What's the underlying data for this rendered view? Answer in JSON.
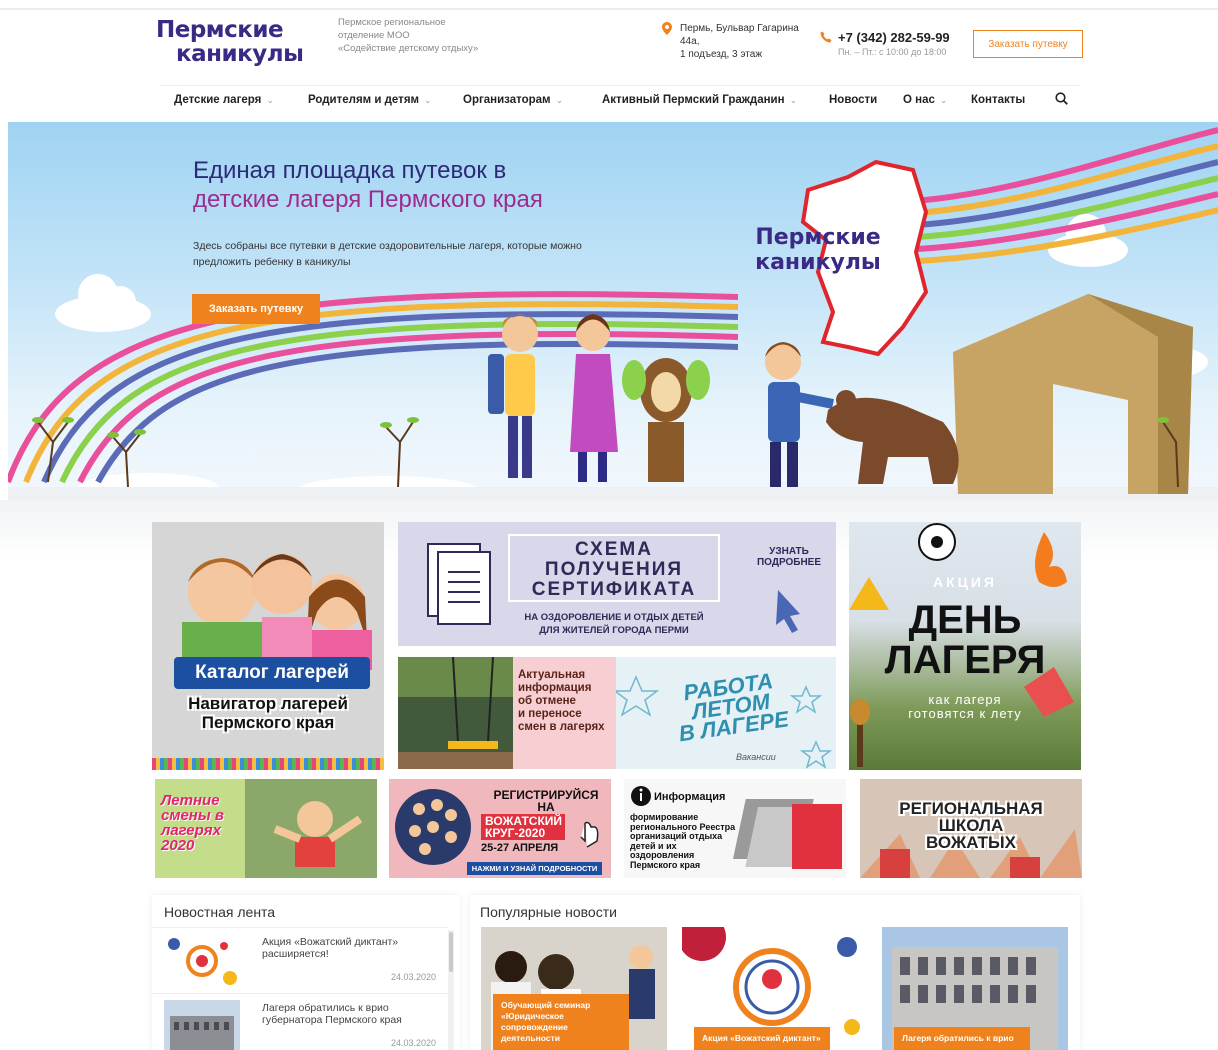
{
  "header": {
    "logo_line1": "Пермские",
    "logo_line2": "каникулы",
    "org_line1": "Пермское региональное",
    "org_line2": "отделение МОО",
    "org_line3": "«Содействие детскому отдыху»",
    "address_line1": "Пермь, Бульвар Гагарина",
    "address_line2": "44а,",
    "address_line3": "1 подъезд, 3 этаж",
    "phone": "+7 (342) 282-59-99",
    "hours": "Пн. – Пт.: с 10:00 до 18:00",
    "order_button": "Заказать путевку"
  },
  "nav": {
    "items": [
      {
        "label": "Детские лагеря",
        "has_dropdown": true
      },
      {
        "label": "Родителям и детям",
        "has_dropdown": true
      },
      {
        "label": "Организаторам",
        "has_dropdown": true
      },
      {
        "label": "Активный Пермский Гражданин",
        "has_dropdown": true
      },
      {
        "label": "Новости",
        "has_dropdown": false
      },
      {
        "label": "О нас",
        "has_dropdown": true
      },
      {
        "label": "Контакты",
        "has_dropdown": false
      }
    ],
    "search_icon": "search-icon"
  },
  "hero": {
    "title_line1": "Единая площадка путевок в",
    "title_line2": "детские лагеря Пермского края",
    "description": "Здесь собраны все путевки в детские оздоровительные лагеря, которые можно предложить ребенку в каникулы",
    "button": "Заказать путевку",
    "logo_line1": "Пермские",
    "logo_line2": "каникулы"
  },
  "banners": {
    "catalog": {
      "badge": "Каталог лагерей",
      "line1": "Навигатор лагерей",
      "line2": "Пермского края"
    },
    "scheme": {
      "title1": "СХЕМА",
      "title2": "ПОЛУЧЕНИЯ",
      "title3": "СЕРТИФИКАТА",
      "sub1": "НА ОЗДОРОВЛЕНИЕ И ОТДЫХ ДЕТЕЙ",
      "sub2": "ДЛЯ ЖИТЕЛЕЙ ГОРОДА ПЕРМИ",
      "more1": "УЗНАТЬ",
      "more2": "ПОДРОБНЕЕ"
    },
    "actual": {
      "line1": "Актуальная",
      "line2": "информация",
      "line3": "об отмене",
      "line4": "и переносе",
      "line5": "смен в лагерях"
    },
    "work": {
      "line1": "РАБОТА",
      "line2": "ЛЕТОМ",
      "line3": "В ЛАГЕРЕ",
      "vacancies": "Вакансии"
    },
    "camp_day": {
      "akcia": "АКЦИЯ",
      "line1": "ДЕНЬ",
      "line2": "ЛАГЕРЯ",
      "sub1": "как лагеря",
      "sub2": "готовятся к лету"
    },
    "summer": {
      "line1": "Летние",
      "line2": "смены в",
      "line3": "лагерях",
      "year": "2020"
    },
    "register": {
      "line1": "РЕГИСТРИРУЙСЯ",
      "line2": "НА",
      "red1": "ВОЖАТСКИЙ",
      "red2": "КРУГ-2020",
      "date": "25-27 АПРЕЛЯ",
      "button": "НАЖМИ И УЗНАЙ ПОДРОБНОСТИ"
    },
    "info": {
      "header": "Информация",
      "l1": "формирование",
      "l2": "регионального Реестра",
      "l3": "организаций отдыха",
      "l4": "детей и их",
      "l5": "оздоровления",
      "l6": "Пермского края"
    },
    "school": {
      "line1": "РЕГИОНАЛЬНАЯ",
      "line2": "ШКОЛА",
      "line3": "ВОЖАТЫХ"
    }
  },
  "news_feed": {
    "title": "Новостная лента",
    "items": [
      {
        "title": "Акция «Вожатский диктант» расширяется!",
        "date": "24.03.2020"
      },
      {
        "title": "Лагеря обратились к врио губернатора Пермского края",
        "date": "24.03.2020"
      }
    ]
  },
  "popular": {
    "title": "Популярные новости",
    "cards": [
      {
        "caption": "Обучающий семинар «Юридическое сопровождение деятельности"
      },
      {
        "caption": "Акция «Вожатский диктант»"
      },
      {
        "caption": "Лагеря обратились к врио"
      }
    ]
  },
  "colors": {
    "brand_purple": "#3a2a86",
    "accent_orange": "#f0821e",
    "title_magenta": "#9b2d8e"
  }
}
